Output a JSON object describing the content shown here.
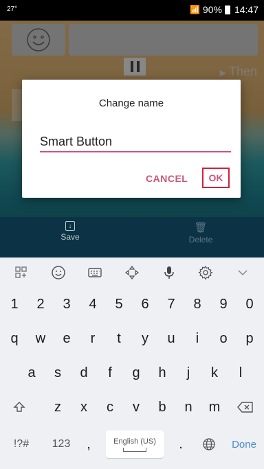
{
  "status_bar": {
    "temperature": "27°",
    "battery": "90%",
    "time": "14:47"
  },
  "app": {
    "then_label": "Then",
    "actions": {
      "save_label": "Save",
      "delete_label": "Delete"
    }
  },
  "dialog": {
    "title": "Change name",
    "input_value": "Smart Button",
    "cancel_label": "CANCEL",
    "ok_label": "OK",
    "accent_color": "#c8567a",
    "highlight_color": "#d0213d"
  },
  "keyboard": {
    "toolbar_icons": [
      "grid-icon",
      "emoji-icon",
      "keyboard-icon",
      "cursor-move-icon",
      "microphone-icon",
      "settings-icon",
      "chevron-down-icon"
    ],
    "rows": [
      [
        "1",
        "2",
        "3",
        "4",
        "5",
        "6",
        "7",
        "8",
        "9",
        "0"
      ],
      [
        "q",
        "w",
        "e",
        "r",
        "t",
        "y",
        "u",
        "i",
        "o",
        "p"
      ],
      [
        "a",
        "s",
        "d",
        "f",
        "g",
        "h",
        "j",
        "k",
        "l"
      ],
      [
        "z",
        "x",
        "c",
        "v",
        "b",
        "n",
        "m"
      ]
    ],
    "symbols_label": "!?#",
    "numbers_label": "123",
    "comma_label": ",",
    "space_label": "English (US)",
    "period_label": ".",
    "done_label": "Done"
  }
}
